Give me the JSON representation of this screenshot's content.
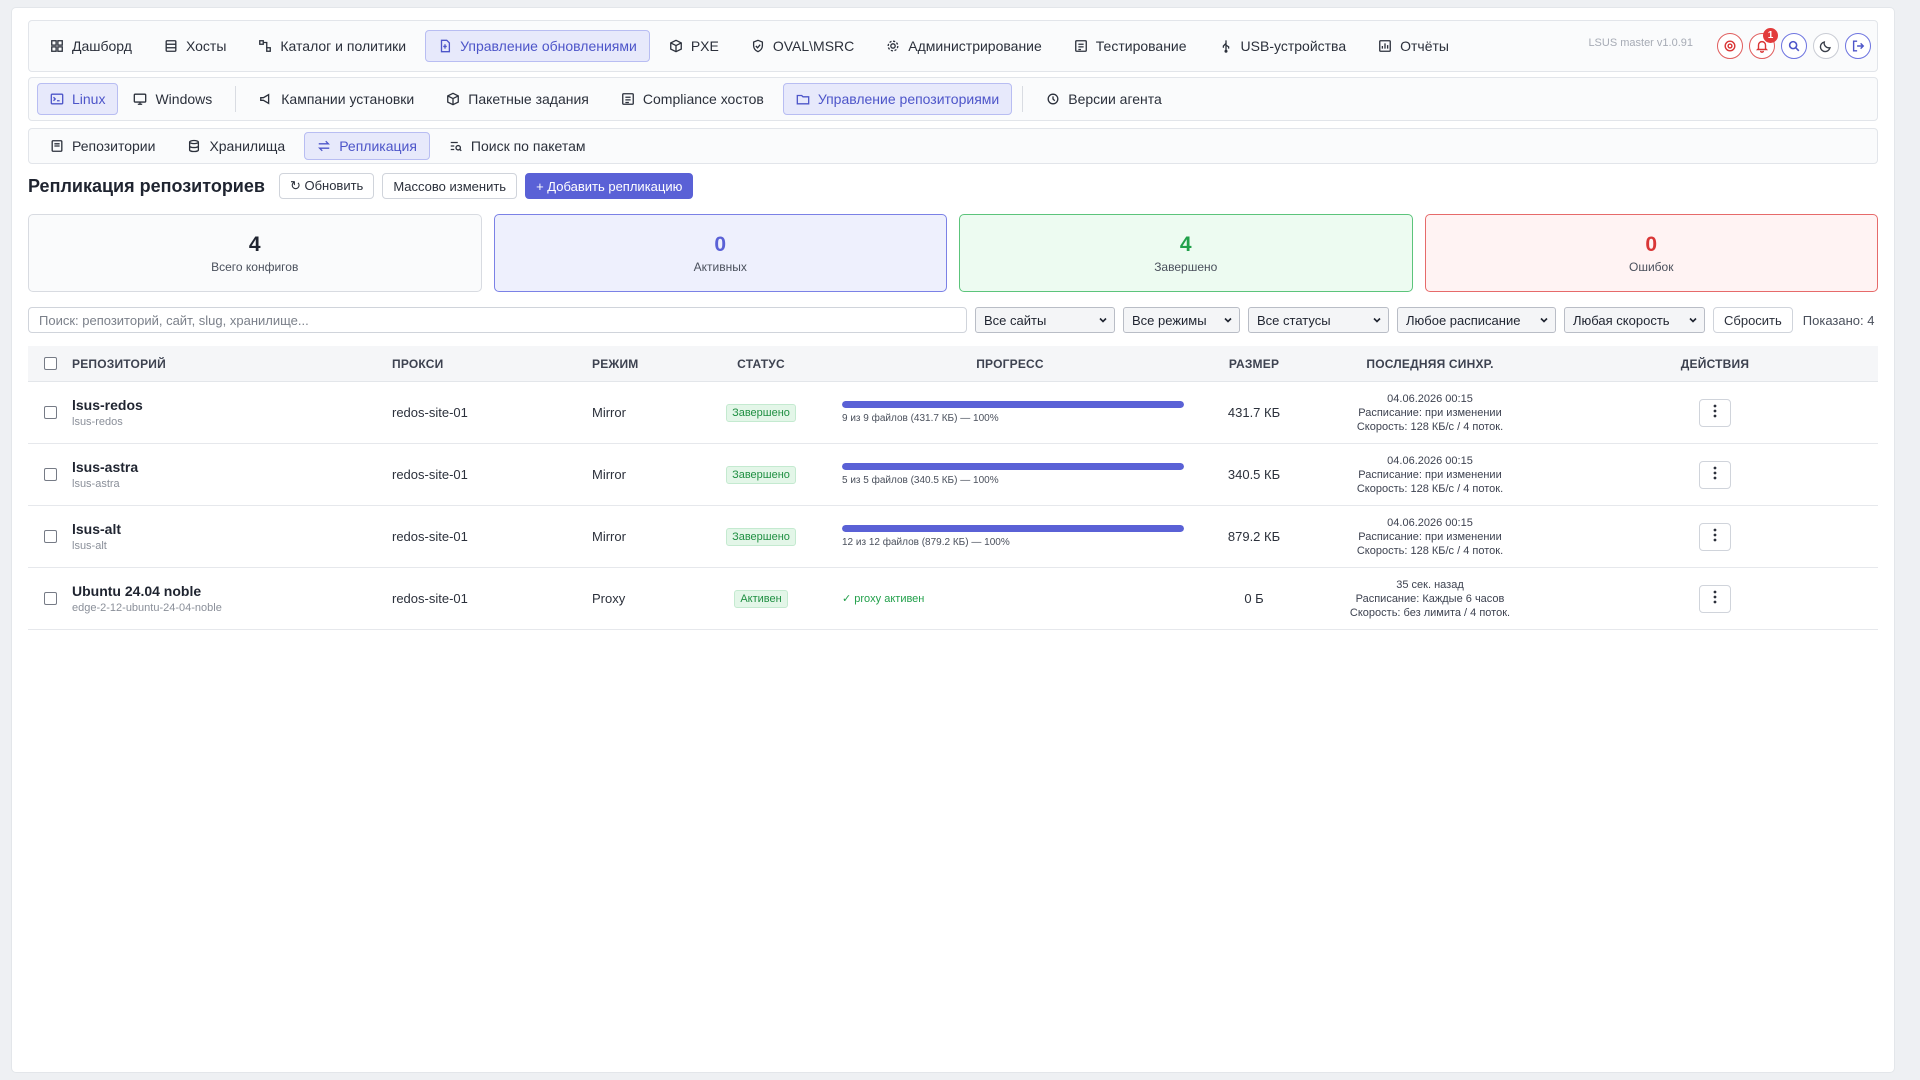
{
  "top_nav": [
    {
      "label": "Дашборд",
      "icon": "dashboard-icon"
    },
    {
      "label": "Хосты",
      "icon": "server-icon"
    },
    {
      "label": "Каталог и политики",
      "icon": "workflow-icon"
    },
    {
      "label": "Управление обновлениями",
      "icon": "file-update-icon",
      "active": true
    },
    {
      "label": "PXE",
      "icon": "box-icon"
    },
    {
      "label": "OVAL\\MSRC",
      "icon": "shield-icon"
    },
    {
      "label": "Администрирование",
      "icon": "gear-icon"
    },
    {
      "label": "Тестирование",
      "icon": "checklist-icon"
    },
    {
      "label": "USB-устройства",
      "icon": "usb-icon"
    },
    {
      "label": "Отчёты",
      "icon": "report-icon"
    }
  ],
  "version": "LSUS master v1.0.91",
  "notifications_count": "1",
  "sub_nav": {
    "os_tabs": [
      {
        "label": "Linux",
        "active": true
      },
      {
        "label": "Windows",
        "active": false
      }
    ],
    "items": [
      {
        "label": "Кампании установки",
        "icon": "megaphone-icon"
      },
      {
        "label": "Пакетные задания",
        "icon": "package-icon"
      },
      {
        "label": "Compliance хостов",
        "icon": "list-check-icon"
      },
      {
        "label": "Управление репозиториями",
        "icon": "folder-icon",
        "active": true
      },
      {
        "label": "Версии агента",
        "icon": "agent-icon"
      }
    ]
  },
  "tert_nav": [
    {
      "label": "Репозитории",
      "icon": "archive-icon"
    },
    {
      "label": "Хранилища",
      "icon": "database-icon"
    },
    {
      "label": "Репликация",
      "icon": "swap-icon",
      "active": true
    },
    {
      "label": "Поиск по пакетам",
      "icon": "text-search-icon"
    }
  ],
  "page": {
    "title": "Репликация репозиториев",
    "refresh_label": "↻ Обновить",
    "bulk_label": "Массово изменить",
    "add_label": "+ Добавить репликацию"
  },
  "stats": {
    "total": {
      "value": "4",
      "label": "Всего конфигов"
    },
    "active": {
      "value": "0",
      "label": "Активных"
    },
    "done": {
      "value": "4",
      "label": "Завершено"
    },
    "errors": {
      "value": "0",
      "label": "Ошибок"
    }
  },
  "filters": {
    "search_placeholder": "Поиск: репозиторий, сайт, slug, хранилище...",
    "sites": "Все сайты",
    "modes": "Все режимы",
    "statuses": "Все статусы",
    "schedule": "Любое расписание",
    "speed": "Любая скорость",
    "reset_label": "Сбросить",
    "shown": "Показано: 4"
  },
  "table": {
    "headers": {
      "repo": "РЕПОЗИТОРИЙ",
      "proxy": "ПРОКСИ",
      "mode": "РЕЖИМ",
      "status": "СТАТУС",
      "progress": "ПРОГРЕСС",
      "size": "РАЗМЕР",
      "sync": "ПОСЛЕДНЯЯ СИНХР.",
      "actions": "ДЕЙСТВИЯ"
    },
    "rows": [
      {
        "name": "lsus-redos",
        "slug": "lsus-redos",
        "proxy": "redos-site-01",
        "mode": "Mirror",
        "status": "Завершено",
        "progress": 1.0,
        "progress_text": "9 из 9 файлов (431.7 КБ) — 100%",
        "size": "431.7 КБ",
        "sync_time": "04.06.2026 00:15",
        "schedule": "Расписание: при изменении",
        "speed": "Скорость: 128 КБ/с / 4 поток."
      },
      {
        "name": "lsus-astra",
        "slug": "lsus-astra",
        "proxy": "redos-site-01",
        "mode": "Mirror",
        "status": "Завершено",
        "progress": 1.0,
        "progress_text": "5 из 5 файлов (340.5 КБ) — 100%",
        "size": "340.5 КБ",
        "sync_time": "04.06.2026 00:15",
        "schedule": "Расписание: при изменении",
        "speed": "Скорость: 128 КБ/с / 4 поток."
      },
      {
        "name": "lsus-alt",
        "slug": "lsus-alt",
        "proxy": "redos-site-01",
        "mode": "Mirror",
        "status": "Завершено",
        "progress": 1.0,
        "progress_text": "12 из 12 файлов (879.2 КБ) — 100%",
        "size": "879.2 КБ",
        "sync_time": "04.06.2026 00:15",
        "schedule": "Расписание: при изменении",
        "speed": "Скорость: 128 КБ/с / 4 поток."
      },
      {
        "name": "Ubuntu 24.04 noble",
        "slug": "edge-2-12-ubuntu-24-04-noble",
        "proxy": "redos-site-01",
        "mode": "Proxy",
        "status": "Активен",
        "proxy_status": "✓ proxy активен",
        "size": "0 Б",
        "sync_time": "35 сек. назад",
        "schedule": "Расписание: Каждые 6 часов",
        "speed": "Скорость: без лимита / 4 поток."
      }
    ]
  }
}
